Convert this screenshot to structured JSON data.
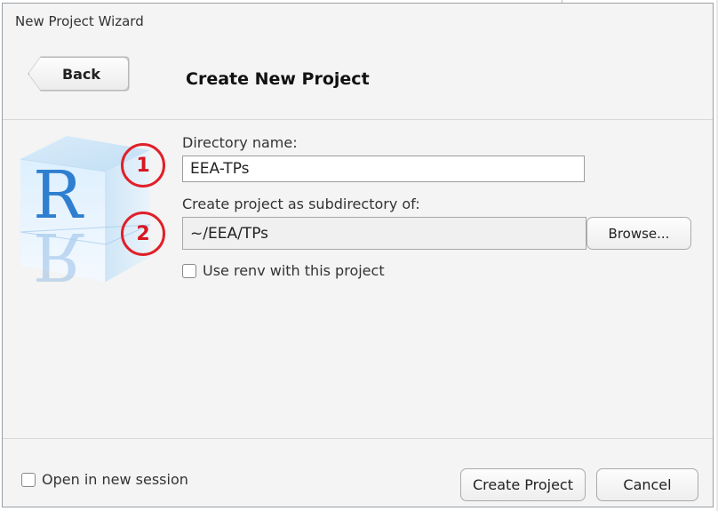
{
  "window": {
    "title": "New Project Wizard"
  },
  "header": {
    "back_label": "Back",
    "page_title": "Create New Project"
  },
  "form": {
    "directory_label": "Directory name:",
    "directory_value": "EEA-TPs",
    "subdir_label": "Create project as subdirectory of:",
    "subdir_value": "~/EEA/TPs",
    "browse_label": "Browse...",
    "renv_label": "Use renv with this project",
    "renv_checked": false
  },
  "annotations": {
    "marker_1": "1",
    "marker_2": "2",
    "marker_color": "#e0202a"
  },
  "footer": {
    "new_session_label": "Open in new session",
    "new_session_checked": false,
    "create_label": "Create Project",
    "cancel_label": "Cancel"
  },
  "logo": {
    "icon": "r-project-logo-icon",
    "letter": "R"
  },
  "colors": {
    "dialog_bg": "#f3f4f3",
    "logo_blue": "#2f7fd0"
  }
}
